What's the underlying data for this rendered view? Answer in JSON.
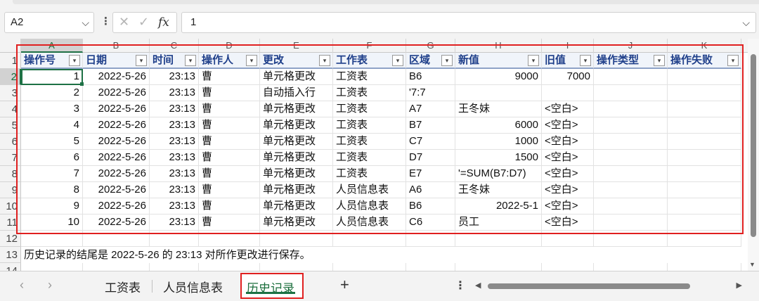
{
  "formula_bar": {
    "name_box": "A2",
    "more_symbol": "⋮",
    "cancel_symbol": "✕",
    "enter_symbol": "✓",
    "fx_label": "fx",
    "value": "1"
  },
  "columns": [
    "A",
    "B",
    "C",
    "D",
    "E",
    "F",
    "G",
    "H",
    "I",
    "J",
    "K"
  ],
  "rows": [
    "1",
    "2",
    "3",
    "4",
    "5",
    "6",
    "7",
    "8",
    "9",
    "10",
    "11",
    "12",
    "13",
    "14"
  ],
  "table": {
    "headers": [
      "操作号",
      "日期",
      "时间",
      "操作人",
      "更改",
      "工作表",
      "区域",
      "新值",
      "旧值",
      "操作类型",
      "操作失败"
    ],
    "data": [
      [
        "1",
        "2022-5-26",
        "23:13",
        "曹",
        "单元格更改",
        "工资表",
        "B6",
        "9000",
        "7000",
        "",
        ""
      ],
      [
        "2",
        "2022-5-26",
        "23:13",
        "曹",
        "自动插入行",
        "工资表",
        "'7:7",
        "",
        "",
        "",
        ""
      ],
      [
        "3",
        "2022-5-26",
        "23:13",
        "曹",
        "单元格更改",
        "工资表",
        "A7",
        "王冬妹",
        "<空白>",
        "",
        ""
      ],
      [
        "4",
        "2022-5-26",
        "23:13",
        "曹",
        "单元格更改",
        "工资表",
        "B7",
        "6000",
        "<空白>",
        "",
        ""
      ],
      [
        "5",
        "2022-5-26",
        "23:13",
        "曹",
        "单元格更改",
        "工资表",
        "C7",
        "1000",
        "<空白>",
        "",
        ""
      ],
      [
        "6",
        "2022-5-26",
        "23:13",
        "曹",
        "单元格更改",
        "工资表",
        "D7",
        "1500",
        "<空白>",
        "",
        ""
      ],
      [
        "7",
        "2022-5-26",
        "23:13",
        "曹",
        "单元格更改",
        "工资表",
        "E7",
        "'=SUM(B7:D7)",
        "<空白>",
        "",
        ""
      ],
      [
        "8",
        "2022-5-26",
        "23:13",
        "曹",
        "单元格更改",
        "人员信息表",
        "A6",
        "王冬妹",
        "<空白>",
        "",
        ""
      ],
      [
        "9",
        "2022-5-26",
        "23:13",
        "曹",
        "单元格更改",
        "人员信息表",
        "B6",
        "2022-5-1",
        "<空白>",
        "",
        ""
      ],
      [
        "10",
        "2022-5-26",
        "23:13",
        "曹",
        "单元格更改",
        "人员信息表",
        "C6",
        "员工",
        "<空白>",
        "",
        ""
      ]
    ]
  },
  "summary_text": "历史记录的结尾是 2022-5-26 的 23:13 对所作更改进行保存。",
  "sheet_tabs": {
    "prev_symbol": "‹",
    "next_symbol": "›",
    "tabs": [
      "工资表",
      "人员信息表",
      "历史记录"
    ],
    "active": "历史记录",
    "add_symbol": "+",
    "more_symbol": "⋮"
  },
  "colors": {
    "accent": "#1e7145",
    "highlight_box": "#e02020",
    "header_text": "#1f3f8a"
  }
}
